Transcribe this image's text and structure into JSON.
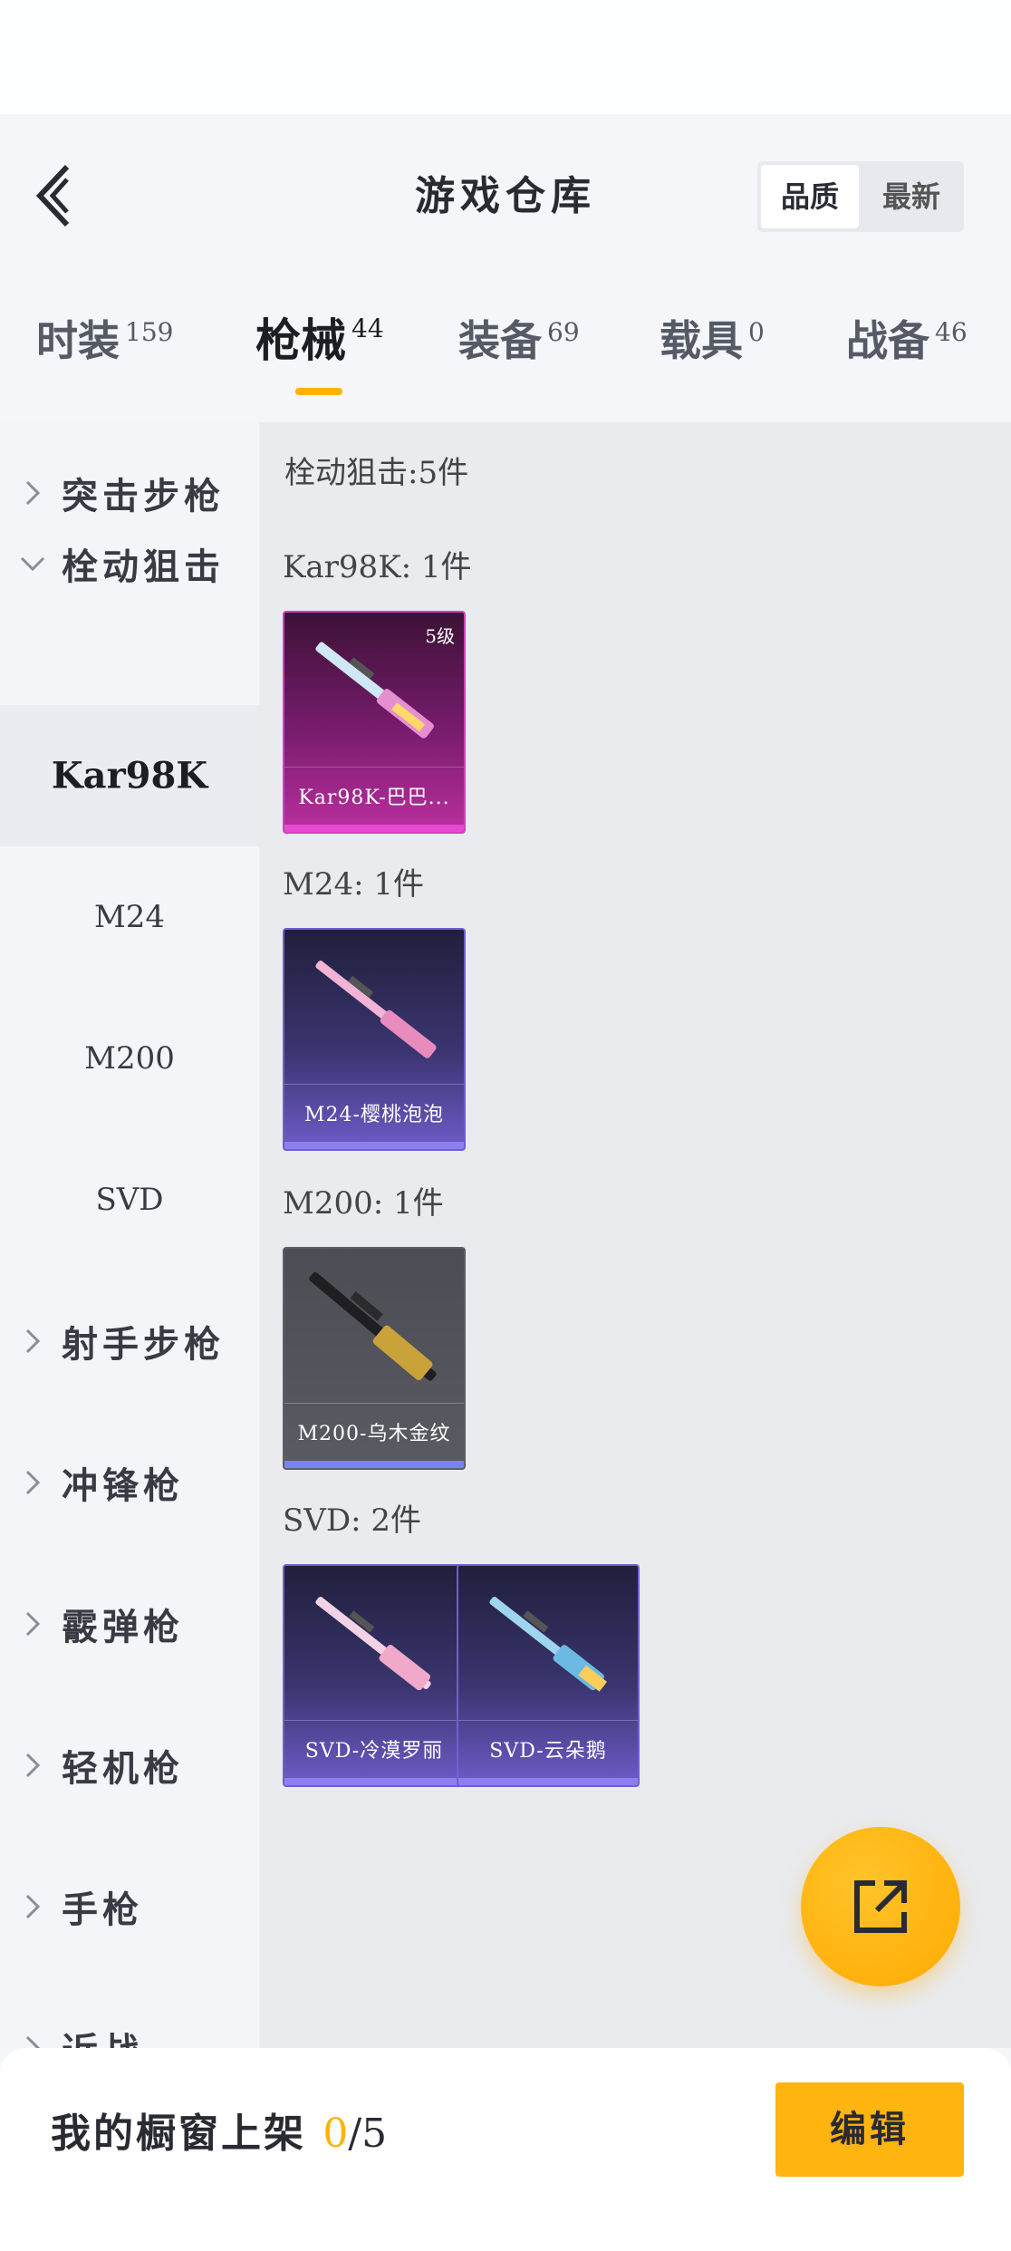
{
  "header": {
    "title": "游戏仓库",
    "sort_options": [
      "品质",
      "最新"
    ],
    "sort_selected": "品质"
  },
  "tabs": [
    {
      "label": "时装",
      "count": "159",
      "active": false
    },
    {
      "label": "枪械",
      "count": "44",
      "active": true
    },
    {
      "label": "装备",
      "count": "69",
      "active": false
    },
    {
      "label": "载具",
      "count": "0",
      "active": false
    },
    {
      "label": "战备",
      "count": "46",
      "active": false
    }
  ],
  "sidebar": {
    "categories": [
      "突击步枪",
      "栓动狙击",
      "射手步枪",
      "冲锋枪",
      "霰弹枪",
      "轻机枪",
      "手枪",
      "近战"
    ],
    "subitems": [
      "Kar98K",
      "M24",
      "M200",
      "SVD"
    ],
    "selected_subitem": "Kar98K"
  },
  "content": {
    "section_title": "栓动狙击:5件",
    "groups": [
      {
        "title": "Kar98K: 1件",
        "items": [
          {
            "name": "Kar98K-巴巴...",
            "level": "5级",
            "rarity": "pink"
          }
        ]
      },
      {
        "title": "M24: 1件",
        "items": [
          {
            "name": "M24-樱桃泡泡",
            "rarity": "purple"
          }
        ]
      },
      {
        "title": "M200: 1件",
        "items": [
          {
            "name": "M200-乌木金纹",
            "rarity": "grey"
          }
        ]
      },
      {
        "title": "SVD: 2件",
        "items": [
          {
            "name": "SVD-冷漠罗丽",
            "rarity": "purple"
          },
          {
            "name": "SVD-云朵鹅",
            "rarity": "purple"
          }
        ]
      }
    ]
  },
  "bottom": {
    "label": "我的橱窗上架 ",
    "shelved": "0",
    "total": "/5",
    "edit_label": "编辑"
  },
  "colors": {
    "accent": "#ffb300",
    "pink_rarity": "#d43fbf",
    "purple_rarity": "#6f5fd0"
  }
}
